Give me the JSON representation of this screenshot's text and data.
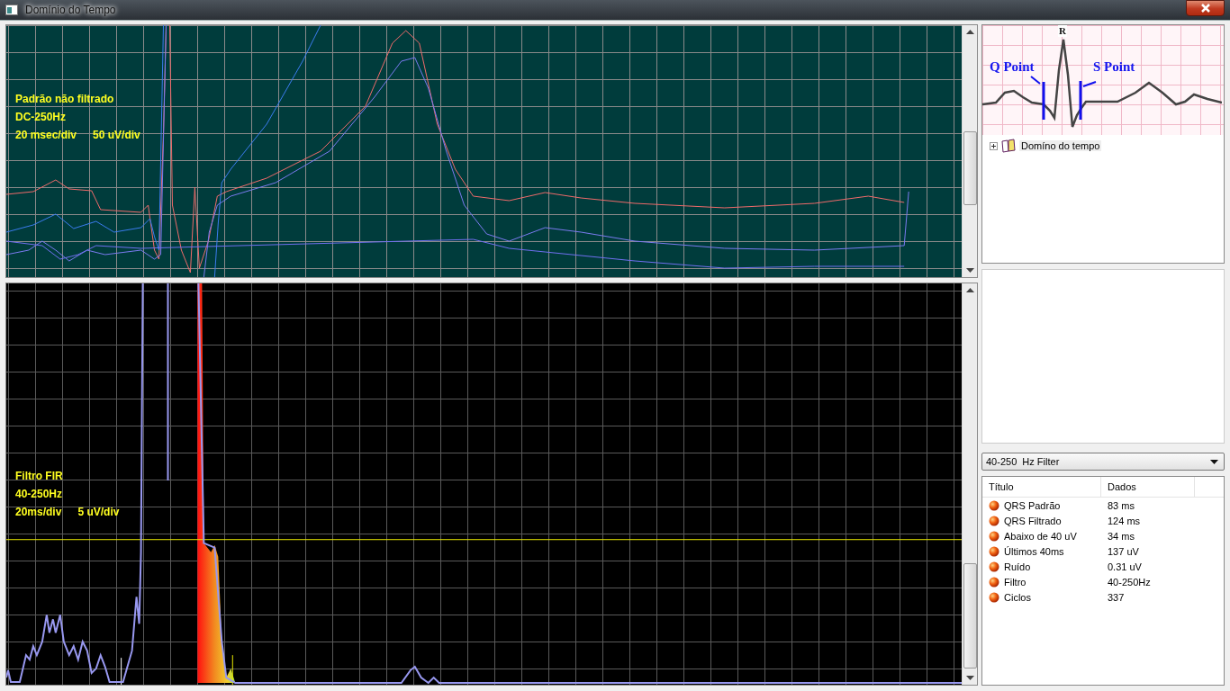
{
  "window": {
    "title": "Domínio do Tempo"
  },
  "top_chart": {
    "labels": [
      "Padrão não filtrado",
      "DC-250Hz",
      "20 msec/div",
      "50 uV/div"
    ]
  },
  "bottom_chart": {
    "labels": [
      "Filtro FIR",
      "40-250Hz",
      "20ms/div",
      "5 uV/div"
    ]
  },
  "ecg_diagram": {
    "labels": [
      "R",
      "Q Point",
      "S Point"
    ]
  },
  "tree": {
    "items": [
      {
        "label": "Domíno do tempo",
        "expanded": false
      }
    ]
  },
  "filter_dropdown": {
    "value": "40-250  Hz Filter"
  },
  "results": {
    "columns": [
      "Título",
      "Dados"
    ],
    "rows": [
      {
        "title": "QRS Padrão",
        "value": "83 ms"
      },
      {
        "title": "QRS Filtrado",
        "value": "124 ms"
      },
      {
        "title": "Abaixo de 40 uV",
        "value": "34 ms"
      },
      {
        "title": "Últimos 40ms",
        "value": "137  uV"
      },
      {
        "title": "Ruído",
        "value": "0.31 uV"
      },
      {
        "title": "Filtro",
        "value": "40-250Hz"
      },
      {
        "title": "Ciclos",
        "value": "337"
      }
    ]
  }
}
